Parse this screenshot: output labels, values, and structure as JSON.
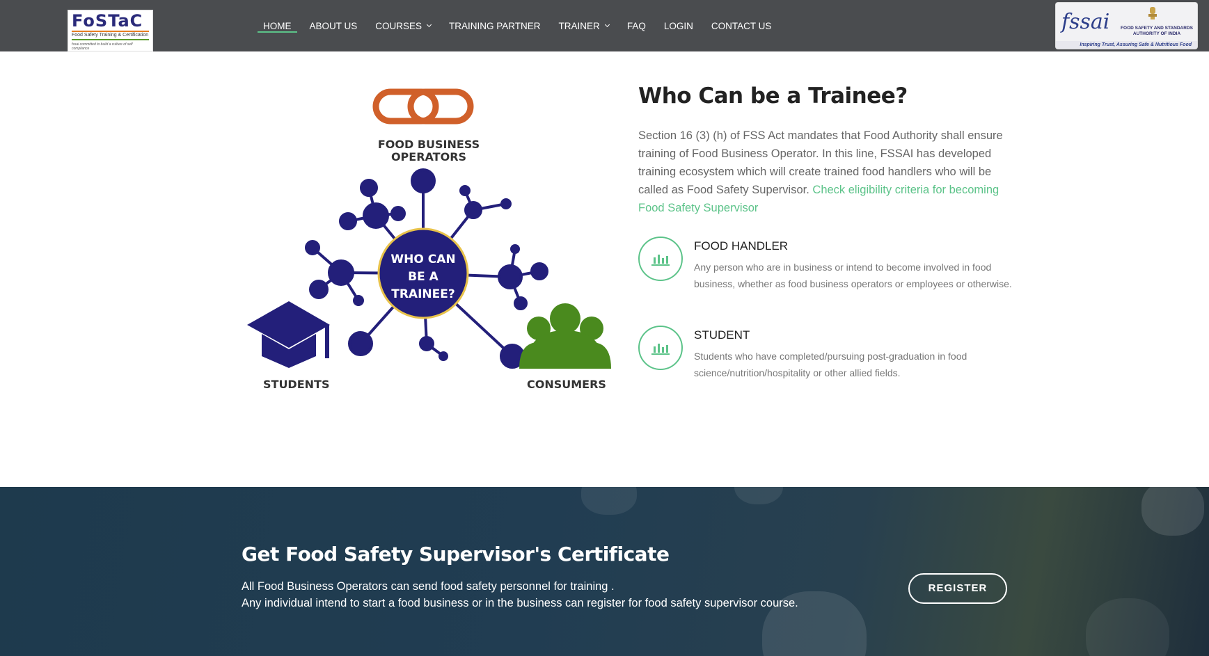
{
  "header": {
    "logo": {
      "title": "FoSTaC",
      "subtitle": "Food Safety Training & Certification",
      "tagline": "fssai committed to build a culture of self compliance"
    },
    "nav": [
      {
        "label": "HOME",
        "active": true
      },
      {
        "label": "ABOUT US"
      },
      {
        "label": "COURSES",
        "dropdown": true
      },
      {
        "label": "TRAINING PARTNER"
      },
      {
        "label": "TRAINER",
        "dropdown": true
      },
      {
        "label": "FAQ"
      },
      {
        "label": "LOGIN"
      },
      {
        "label": "CONTACT US"
      }
    ],
    "fssai": {
      "wordmark": "fssai",
      "authority": "FOOD SAFETY AND STANDARDS AUTHORITY OF INDIA",
      "strip": "Inspiring Trust, Assuring Safe & Nutritious Food"
    }
  },
  "diagram": {
    "center_lines": [
      "WHO CAN",
      "BE A",
      "TRAINEE?"
    ],
    "food_business_lines": [
      "FOOD BUSINESS",
      "OPERATORS"
    ],
    "students": "STUDENTS",
    "consumers": "CONSUMERS",
    "colors": {
      "network": "#231f7a",
      "chain": "#d0602a",
      "cap": "#231f7a",
      "people": "#4a8a1e"
    }
  },
  "trainee": {
    "title": "Who Can be a Trainee?",
    "intro": "Section 16 (3) (h) of FSS Act mandates that Food Authority shall ensure training of Food Business Operator. In this line, FSSAI has developed training ecosystem which will create trained food handlers who will be called as Food Safety Supervisor.",
    "link": "Check eligibility criteria for becoming Food Safety Supervisor",
    "items": [
      {
        "title": "FOOD HANDLER",
        "desc": "Any person who are in business or intend to become involved in food business, whether as food business operators or employees or otherwise.",
        "icon": "bar-chart-icon"
      },
      {
        "title": "STUDENT",
        "desc": "Students who have completed/pursuing post-graduation in food science/nutrition/hospitality or other allied fields.",
        "icon": "bar-chart-icon"
      }
    ]
  },
  "banner": {
    "title": "Get Food Safety Supervisor's Certificate",
    "line1": "All Food Business Operators can send food safety personnel for training .",
    "line2": "Any individual intend to start a food business or in the business can register for food safety supervisor course.",
    "button": "REGISTER"
  },
  "colors": {
    "header_bg": "#4a4c4f",
    "accent": "#5cc389"
  }
}
